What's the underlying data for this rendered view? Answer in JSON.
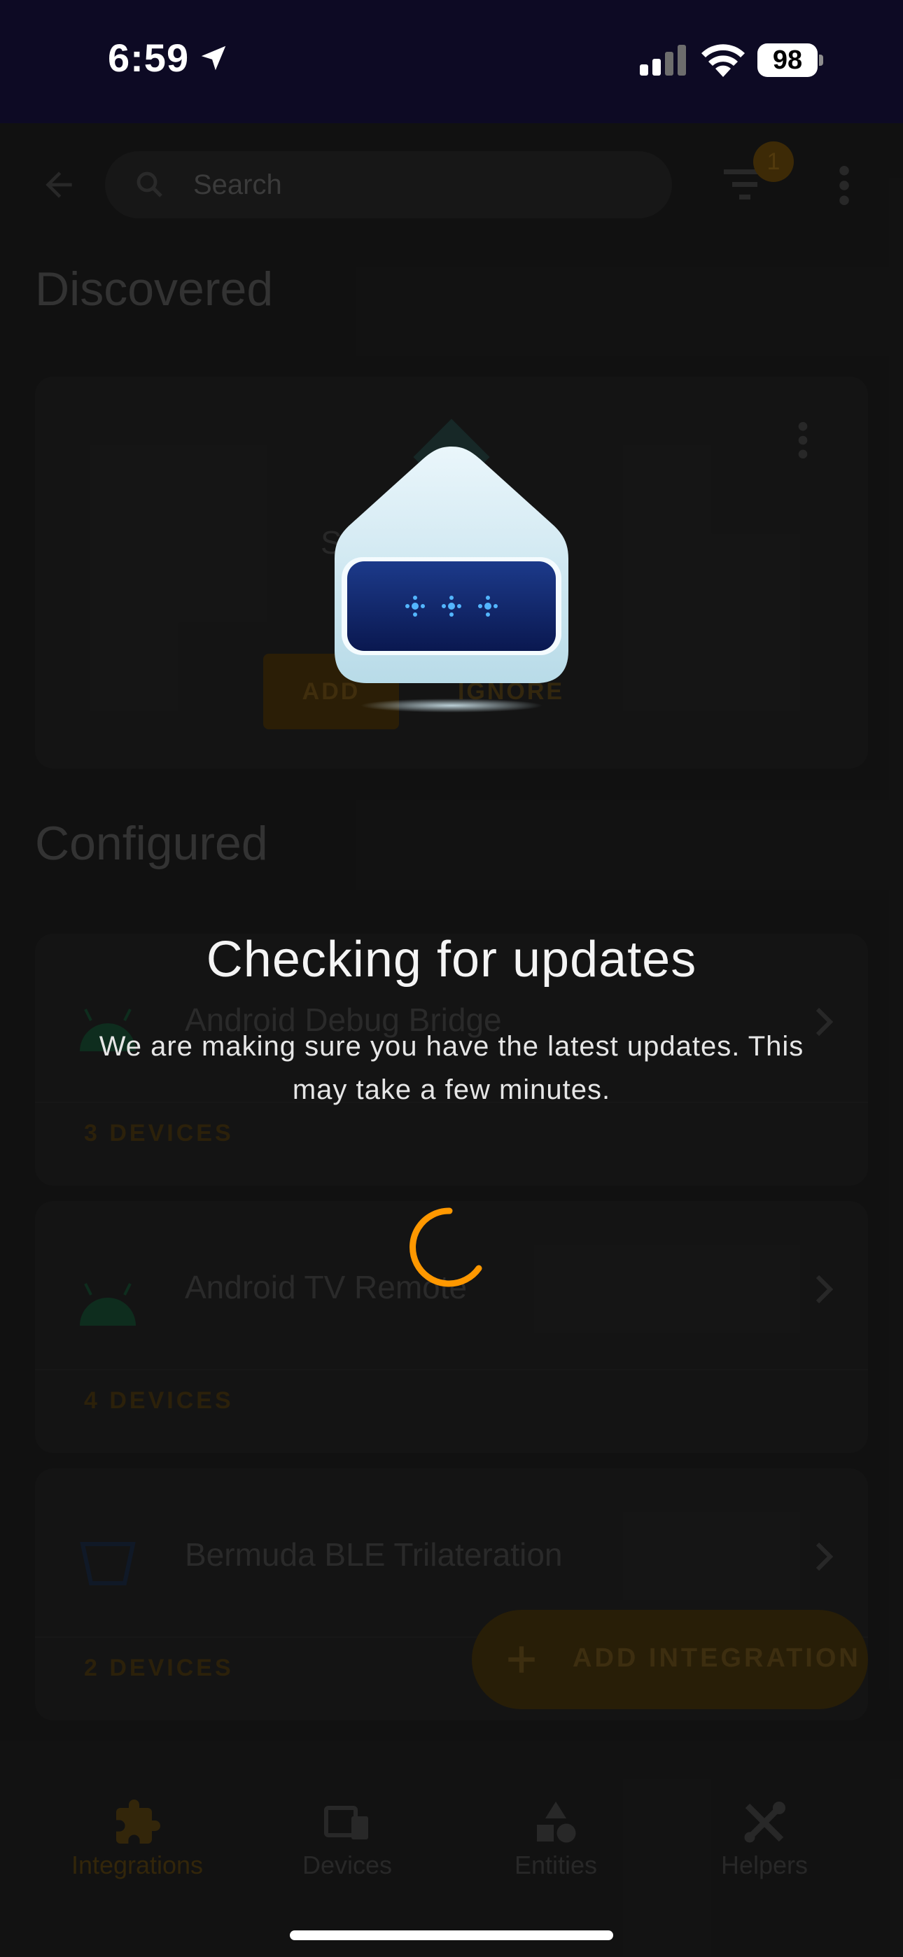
{
  "status_bar": {
    "time": "6:59",
    "battery": "98"
  },
  "header": {
    "search_placeholder": "Search",
    "filter_badge": "1"
  },
  "discovered": {
    "heading": "Discovered",
    "card": {
      "name": "S                      c",
      "add_label": "ADD",
      "ignore_label": "IGNORE"
    }
  },
  "configured": {
    "heading": "Configured",
    "items": [
      {
        "name": "Android Debug Bridge",
        "devices": "3 DEVICES",
        "icon": "android-icon"
      },
      {
        "name": "Android TV Remote",
        "devices": "4 DEVICES",
        "icon": "android-icon"
      },
      {
        "name": "Bermuda BLE Trilateration",
        "devices": "2 DEVICES",
        "icon": "bermuda-icon"
      }
    ]
  },
  "fab": {
    "label": "ADD INTEGRATION"
  },
  "bottom_nav": [
    {
      "label": "Integrations",
      "icon": "puzzle-icon",
      "active": true
    },
    {
      "label": "Devices",
      "icon": "devices-icon",
      "active": false
    },
    {
      "label": "Entities",
      "icon": "shapes-icon",
      "active": false
    },
    {
      "label": "Helpers",
      "icon": "tools-icon",
      "active": false
    }
  ],
  "overlay": {
    "title": "Checking for updates",
    "body": "We are making sure you have the latest updates. This may take a few minutes."
  },
  "colors": {
    "accent": "#ff9800",
    "status_bar_bg": "#0d0a24",
    "android_green": "#3ddc84"
  }
}
